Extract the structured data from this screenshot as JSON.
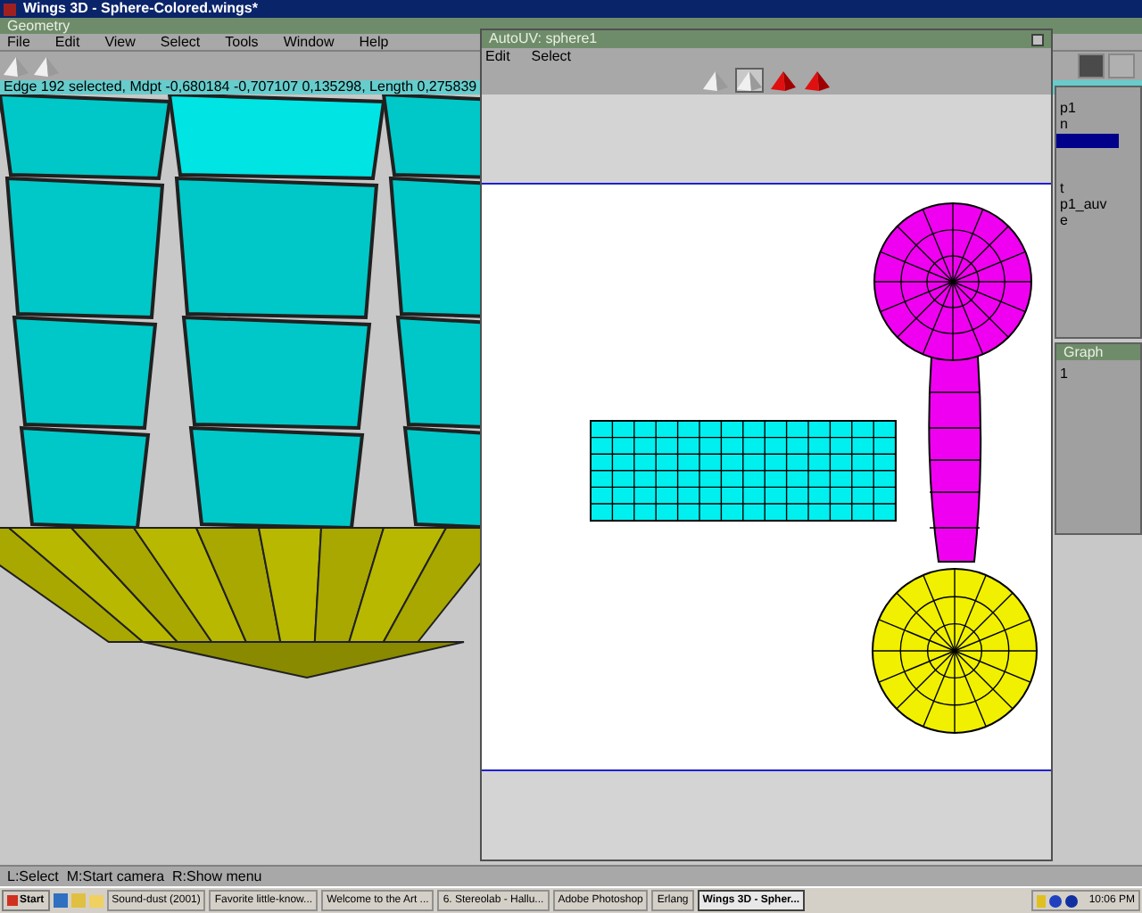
{
  "window": {
    "title": "Wings 3D - Sphere-Colored.wings*"
  },
  "geometry_bar": {
    "title": "Geometry"
  },
  "menu": [
    "File",
    "Edit",
    "View",
    "Select",
    "Tools",
    "Window",
    "Help"
  ],
  "info_line": "Edge 192 selected, Mdpt -0,680184 -0,707107 0,135298, Length 0,275839",
  "outliner": {
    "items": [
      {
        "label": "p1",
        "selected": false
      },
      {
        "label": "n",
        "selected": false
      },
      {
        "selected": true
      },
      {
        "label": "t",
        "selected": false
      },
      {
        "label": "p1_auv",
        "selected": false
      },
      {
        "label": "e",
        "selected": false
      }
    ]
  },
  "graph": {
    "title": "Graph",
    "items": [
      "1"
    ]
  },
  "autouv": {
    "title": "AutoUV: sphere1",
    "menu": [
      "Edit",
      "Select"
    ],
    "modes": [
      {
        "selected": false
      },
      {
        "selected": true
      },
      {
        "selected": false
      },
      {
        "selected": false
      }
    ]
  },
  "status_bar": "L:Select  M:Start camera  R:Show menu",
  "taskbar": {
    "start": "Start",
    "tasks": [
      {
        "label": "Sound-dust (2001)",
        "selected": false
      },
      {
        "label": "Favorite little-know...",
        "selected": false
      },
      {
        "label": "Welcome to the Art ...",
        "selected": false
      },
      {
        "label": "6. Stereolab - Hallu...",
        "selected": false
      },
      {
        "label": "Adobe Photoshop",
        "selected": false
      },
      {
        "label": "Erlang",
        "selected": false
      },
      {
        "label": "Wings 3D - Spher...",
        "selected": true
      }
    ],
    "clock": "10:06 PM"
  }
}
